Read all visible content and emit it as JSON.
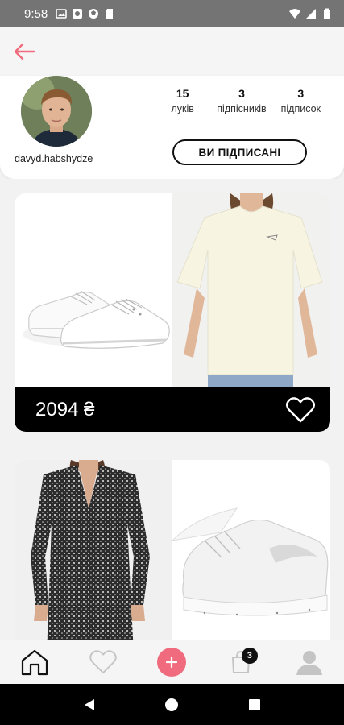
{
  "status_bar": {
    "time": "9:58",
    "icons": [
      "image-icon",
      "photo-icon",
      "ball-icon",
      "sd-card-icon"
    ],
    "right_icons": [
      "wifi-icon",
      "signal-icon",
      "battery-icon"
    ]
  },
  "header": {
    "back_icon": "arrow-left-icon",
    "accent_color": "#f06b7d"
  },
  "profile": {
    "username": "davyd.habshydze",
    "stats": [
      {
        "value": "15",
        "label": "луків"
      },
      {
        "value": "3",
        "label": "підпісників"
      },
      {
        "value": "3",
        "label": "підписок"
      }
    ],
    "follow_label": "ВИ ПІДПИСАНІ"
  },
  "looks": [
    {
      "price": "2094 ₴",
      "items": [
        "white-sneakers",
        "cream-tshirt"
      ],
      "liked": false
    },
    {
      "items": [
        "printed-dress",
        "white-sneakers-nike"
      ]
    }
  ],
  "bottom_nav": {
    "items": [
      "home-icon",
      "heart-icon",
      "add-icon",
      "cart-icon",
      "profile-icon"
    ],
    "cart_count": "3",
    "add_color": "#f06b7d"
  },
  "system_nav": [
    "back-triangle-icon",
    "home-circle-icon",
    "recents-square-icon"
  ]
}
